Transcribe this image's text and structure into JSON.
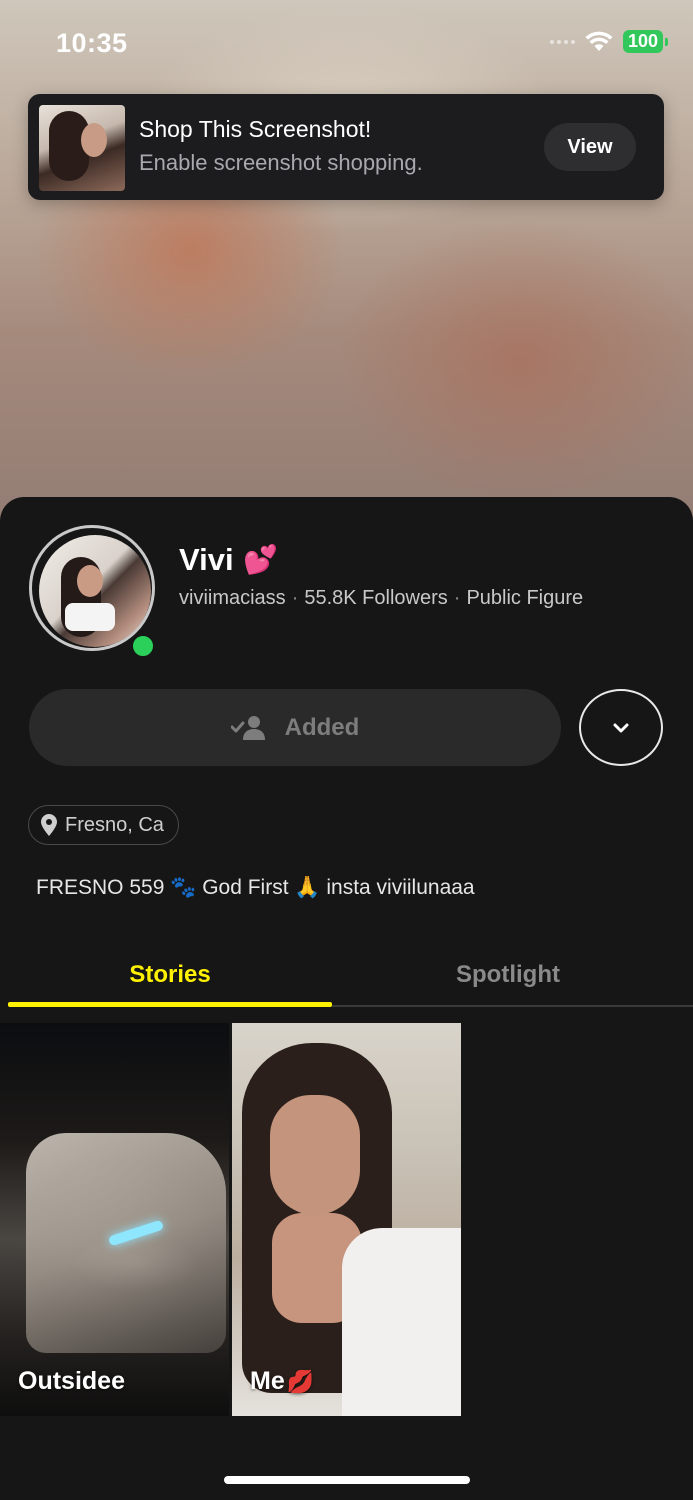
{
  "status_bar": {
    "time": "10:35",
    "battery": "100"
  },
  "notification": {
    "title": "Shop This Screenshot!",
    "subtitle": "Enable screenshot shopping.",
    "action_label": "View"
  },
  "profile": {
    "name": "Vivi",
    "name_emoji": "💕",
    "username": "viviimaciass",
    "followers": "55.8K Followers",
    "category": "Public Figure",
    "online": true,
    "added_label": "Added",
    "location": "Fresno, Ca",
    "bio": "FRESNO 559 🐾 God First 🙏 insta viviilunaaa"
  },
  "tabs": [
    {
      "label": "Stories",
      "active": true
    },
    {
      "label": "Spotlight",
      "active": false
    }
  ],
  "stories": [
    {
      "label": "Outsidee"
    },
    {
      "label": "Me",
      "emoji": "💋"
    }
  ],
  "colors": {
    "accent": "#fff200",
    "online": "#2bd05a",
    "battery": "#32c75a"
  },
  "icons": {
    "added": "add-friend-check-icon",
    "more": "chevron-down-icon",
    "location": "location-pin-icon",
    "wifi": "wifi-icon"
  }
}
